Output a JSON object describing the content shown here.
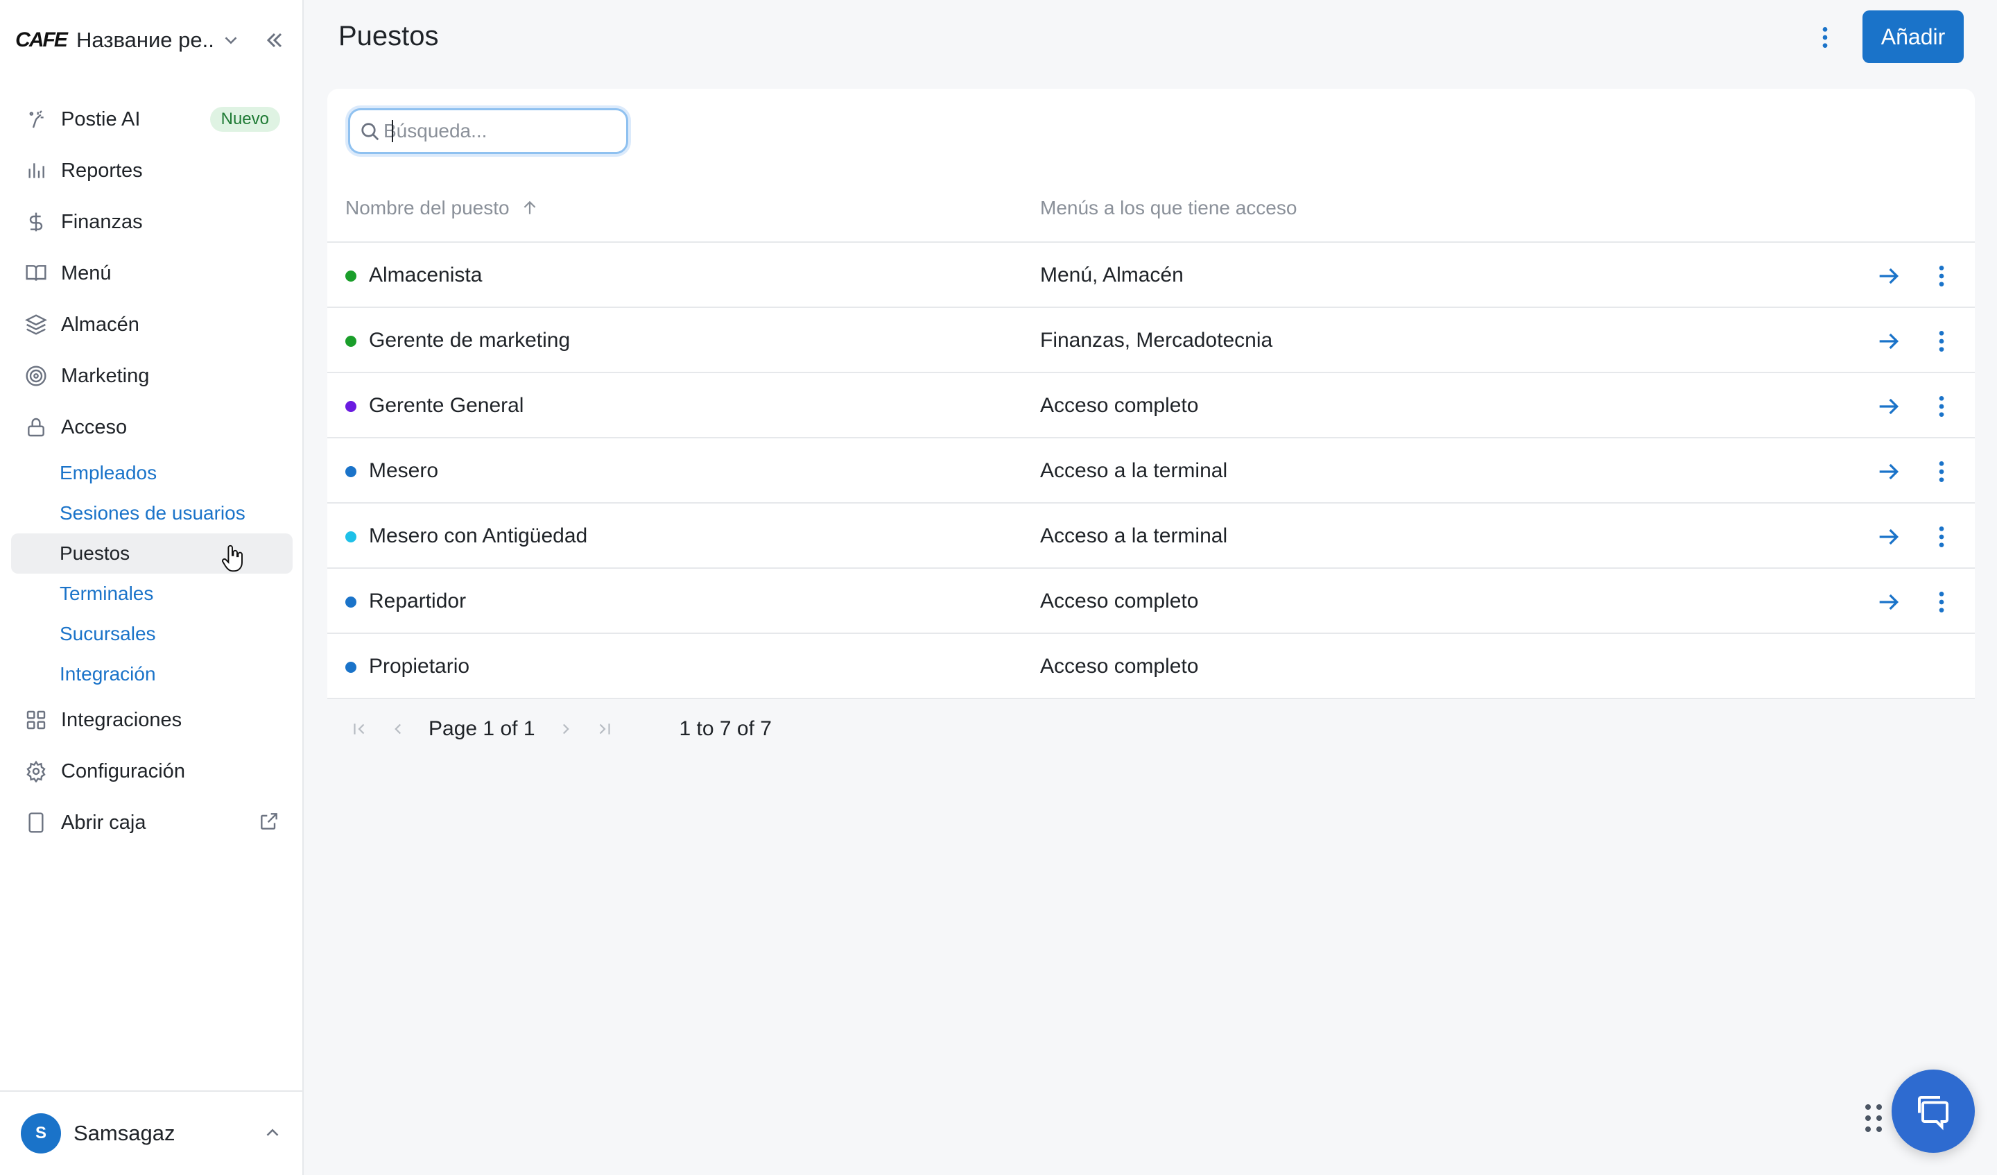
{
  "sidebar": {
    "brand_logo_text": "CAFE",
    "brand_name": "Название ре...",
    "items": [
      {
        "label": "Postie AI",
        "icon": "ai-wand-icon",
        "badge": "Nuevo"
      },
      {
        "label": "Reportes",
        "icon": "bar-chart-icon"
      },
      {
        "label": "Finanzas",
        "icon": "dollar-icon"
      },
      {
        "label": "Menú",
        "icon": "book-icon"
      },
      {
        "label": "Almacén",
        "icon": "layers-icon"
      },
      {
        "label": "Marketing",
        "icon": "target-icon"
      },
      {
        "label": "Acceso",
        "icon": "lock-icon"
      }
    ],
    "sub_items": [
      {
        "label": "Empleados"
      },
      {
        "label": "Sesiones de usuarios"
      },
      {
        "label": "Puestos",
        "active": true
      },
      {
        "label": "Terminales"
      },
      {
        "label": "Sucursales"
      },
      {
        "label": "Integración"
      }
    ],
    "items_after": [
      {
        "label": "Integraciones",
        "icon": "grid-icon"
      },
      {
        "label": "Configuración",
        "icon": "gear-icon"
      },
      {
        "label": "Abrir caja",
        "icon": "tablet-icon"
      }
    ],
    "user": {
      "initial": "S",
      "name": "Samsagaz"
    }
  },
  "header": {
    "title": "Puestos",
    "add_label": "Añadir"
  },
  "search": {
    "placeholder": "Búsqueda..."
  },
  "table": {
    "columns": [
      "Nombre del puesto",
      "Menús a los que tiene acceso"
    ],
    "rows": [
      {
        "name": "Almacenista",
        "menus": "Menú, Almacén",
        "color": "#1a9e2a",
        "actions": true
      },
      {
        "name": "Gerente de marketing",
        "menus": "Finanzas, Mercadotecnia",
        "color": "#1a9e2a",
        "actions": true
      },
      {
        "name": "Gerente General",
        "menus": "Acceso completo",
        "color": "#6a1be0",
        "actions": true
      },
      {
        "name": "Mesero",
        "menus": "Acceso a la terminal",
        "color": "#1a73c9",
        "actions": true
      },
      {
        "name": "Mesero con Antigüedad",
        "menus": "Acceso a la terminal",
        "color": "#1ec0e8",
        "actions": true
      },
      {
        "name": "Repartidor",
        "menus": "Acceso completo",
        "color": "#1a73c9",
        "actions": true
      },
      {
        "name": "Propietario",
        "menus": "Acceso completo",
        "color": "#1a73c9",
        "actions": false
      }
    ]
  },
  "pagination": {
    "page_label": "Page",
    "page": "1",
    "of_label": "of",
    "total_pages": "1",
    "range": "1 to 7 of 7"
  },
  "colors": {
    "accent": "#1a73c9",
    "chat": "#2e6bd0"
  }
}
